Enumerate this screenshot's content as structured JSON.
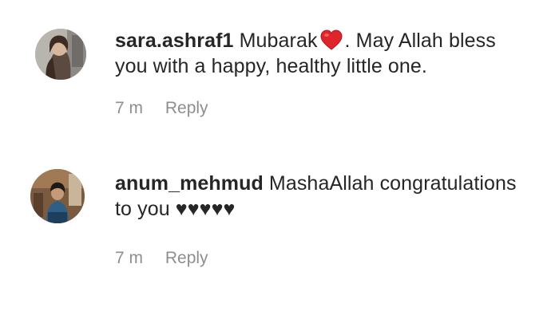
{
  "comments": [
    {
      "username": "sara.ashraf1",
      "text_before": "Mubarak",
      "emoji": "red-heart",
      "text_after": ". May Allah bless you with a happy, healthy little one.",
      "time": "7 m",
      "reply_label": "Reply"
    },
    {
      "username": "anum_mehmud",
      "text_before": "MashaAllah congratulations to you ♥♥♥♥♥",
      "time": "7 m",
      "reply_label": "Reply"
    }
  ],
  "colors": {
    "text": "#262626",
    "meta": "#8e8e8e",
    "heart": "#e0242b"
  }
}
